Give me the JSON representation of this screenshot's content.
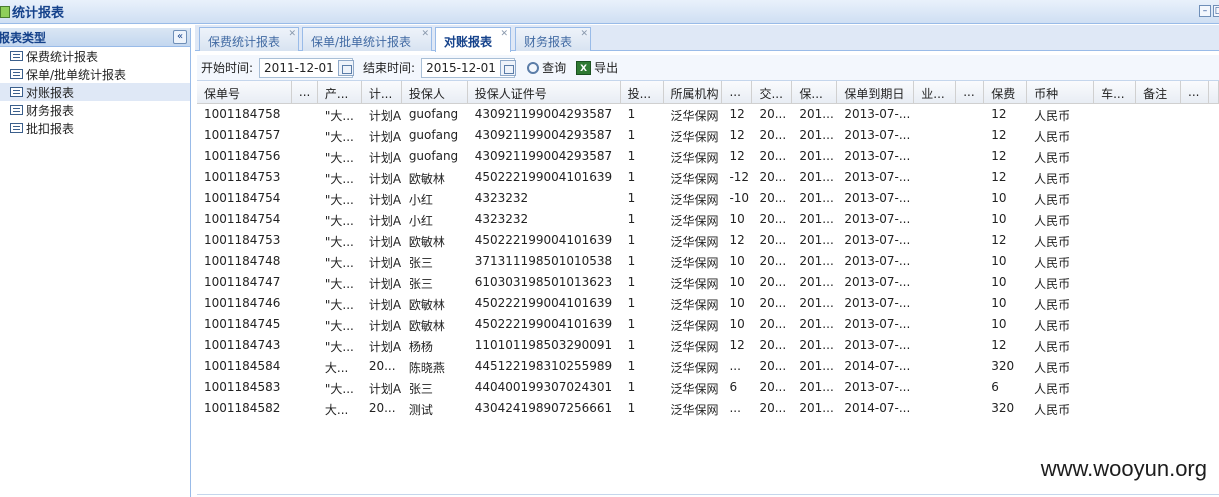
{
  "window": {
    "title": "统计报表"
  },
  "sidebar": {
    "title": "报表类型",
    "items": [
      {
        "label": "保费统计报表"
      },
      {
        "label": "保单/批单统计报表"
      },
      {
        "label": "对账报表"
      },
      {
        "label": "财务报表"
      },
      {
        "label": "批扣报表"
      }
    ],
    "selected_index": 2
  },
  "tabs": [
    {
      "label": "保费统计报表"
    },
    {
      "label": "保单/批单统计报表"
    },
    {
      "label": "对账报表"
    },
    {
      "label": "财务报表"
    }
  ],
  "active_tab": 2,
  "toolbar": {
    "start_label": "开始时间:",
    "start_value": "2011-12-01",
    "end_label": "结束时间:",
    "end_value": "2015-12-01",
    "query_label": "查询",
    "export_label": "导出"
  },
  "grid": {
    "columns": [
      "保单号",
      "...",
      "产...",
      "计...",
      "投保人",
      "投保人证件号",
      "投...",
      "所属机构",
      "...",
      "交...",
      "保...",
      "保单到期日",
      "业...",
      "...",
      "保费",
      "币种",
      "车...",
      "备注",
      "...",
      ""
    ],
    "rows": [
      [
        "1001184758",
        "",
        "\"大...",
        "计划A",
        "guofang",
        "430921199004293587",
        "1",
        "泛华保网",
        "12",
        "20...",
        "201...",
        "2013-07-...",
        "",
        "",
        "12",
        "人民币",
        "",
        "",
        "",
        ""
      ],
      [
        "1001184757",
        "",
        "\"大...",
        "计划A",
        "guofang",
        "430921199004293587",
        "1",
        "泛华保网",
        "12",
        "20...",
        "201...",
        "2013-07-...",
        "",
        "",
        "12",
        "人民币",
        "",
        "",
        "",
        ""
      ],
      [
        "1001184756",
        "",
        "\"大...",
        "计划A",
        "guofang",
        "430921199004293587",
        "1",
        "泛华保网",
        "12",
        "20...",
        "201...",
        "2013-07-...",
        "",
        "",
        "12",
        "人民币",
        "",
        "",
        "",
        ""
      ],
      [
        "1001184753",
        "",
        "\"大...",
        "计划A",
        "欧敏林",
        "450222199004101639",
        "1",
        "泛华保网",
        "-12",
        "20...",
        "201...",
        "2013-07-...",
        "",
        "",
        "12",
        "人民币",
        "",
        "",
        "",
        ""
      ],
      [
        "1001184754",
        "",
        "\"大...",
        "计划A",
        "小红",
        "4323232",
        "1",
        "泛华保网",
        "-10",
        "20...",
        "201...",
        "2013-07-...",
        "",
        "",
        "10",
        "人民币",
        "",
        "",
        "",
        ""
      ],
      [
        "1001184754",
        "",
        "\"大...",
        "计划A",
        "小红",
        "4323232",
        "1",
        "泛华保网",
        "10",
        "20...",
        "201...",
        "2013-07-...",
        "",
        "",
        "10",
        "人民币",
        "",
        "",
        "",
        ""
      ],
      [
        "1001184753",
        "",
        "\"大...",
        "计划A",
        "欧敏林",
        "450222199004101639",
        "1",
        "泛华保网",
        "12",
        "20...",
        "201...",
        "2013-07-...",
        "",
        "",
        "12",
        "人民币",
        "",
        "",
        "",
        ""
      ],
      [
        "1001184748",
        "",
        "\"大...",
        "计划A",
        "张三",
        "371311198501010538",
        "1",
        "泛华保网",
        "10",
        "20...",
        "201...",
        "2013-07-...",
        "",
        "",
        "10",
        "人民币",
        "",
        "",
        "",
        ""
      ],
      [
        "1001184747",
        "",
        "\"大...",
        "计划A",
        "张三",
        "610303198501013623",
        "1",
        "泛华保网",
        "10",
        "20...",
        "201...",
        "2013-07-...",
        "",
        "",
        "10",
        "人民币",
        "",
        "",
        "",
        ""
      ],
      [
        "1001184746",
        "",
        "\"大...",
        "计划A",
        "欧敏林",
        "450222199004101639",
        "1",
        "泛华保网",
        "10",
        "20...",
        "201...",
        "2013-07-...",
        "",
        "",
        "10",
        "人民币",
        "",
        "",
        "",
        ""
      ],
      [
        "1001184745",
        "",
        "\"大...",
        "计划A",
        "欧敏林",
        "450222199004101639",
        "1",
        "泛华保网",
        "10",
        "20...",
        "201...",
        "2013-07-...",
        "",
        "",
        "10",
        "人民币",
        "",
        "",
        "",
        ""
      ],
      [
        "1001184743",
        "",
        "\"大...",
        "计划A",
        "杨杨",
        "110101198503290091",
        "1",
        "泛华保网",
        "12",
        "20...",
        "201...",
        "2013-07-...",
        "",
        "",
        "12",
        "人民币",
        "",
        "",
        "",
        ""
      ],
      [
        "1001184584",
        "",
        "大...",
        "20...",
        "陈晓燕",
        "445122198310255989",
        "1",
        "泛华保网",
        "...",
        "20...",
        "201...",
        "2014-07-...",
        "",
        "",
        "320",
        "人民币",
        "",
        "",
        "",
        ""
      ],
      [
        "1001184583",
        "",
        "\"大...",
        "计划A",
        "张三",
        "440400199307024301",
        "1",
        "泛华保网",
        "6",
        "20...",
        "201...",
        "2013-07-...",
        "",
        "",
        "6",
        "人民币",
        "",
        "",
        "",
        ""
      ],
      [
        "1001184582",
        "",
        "大...",
        "20...",
        "测试",
        "430424198907256661",
        "1",
        "泛华保网",
        "...",
        "20...",
        "201...",
        "2014-07-...",
        "",
        "",
        "320",
        "人民币",
        "",
        "",
        "",
        ""
      ]
    ]
  },
  "watermark": "www.wooyun.org"
}
